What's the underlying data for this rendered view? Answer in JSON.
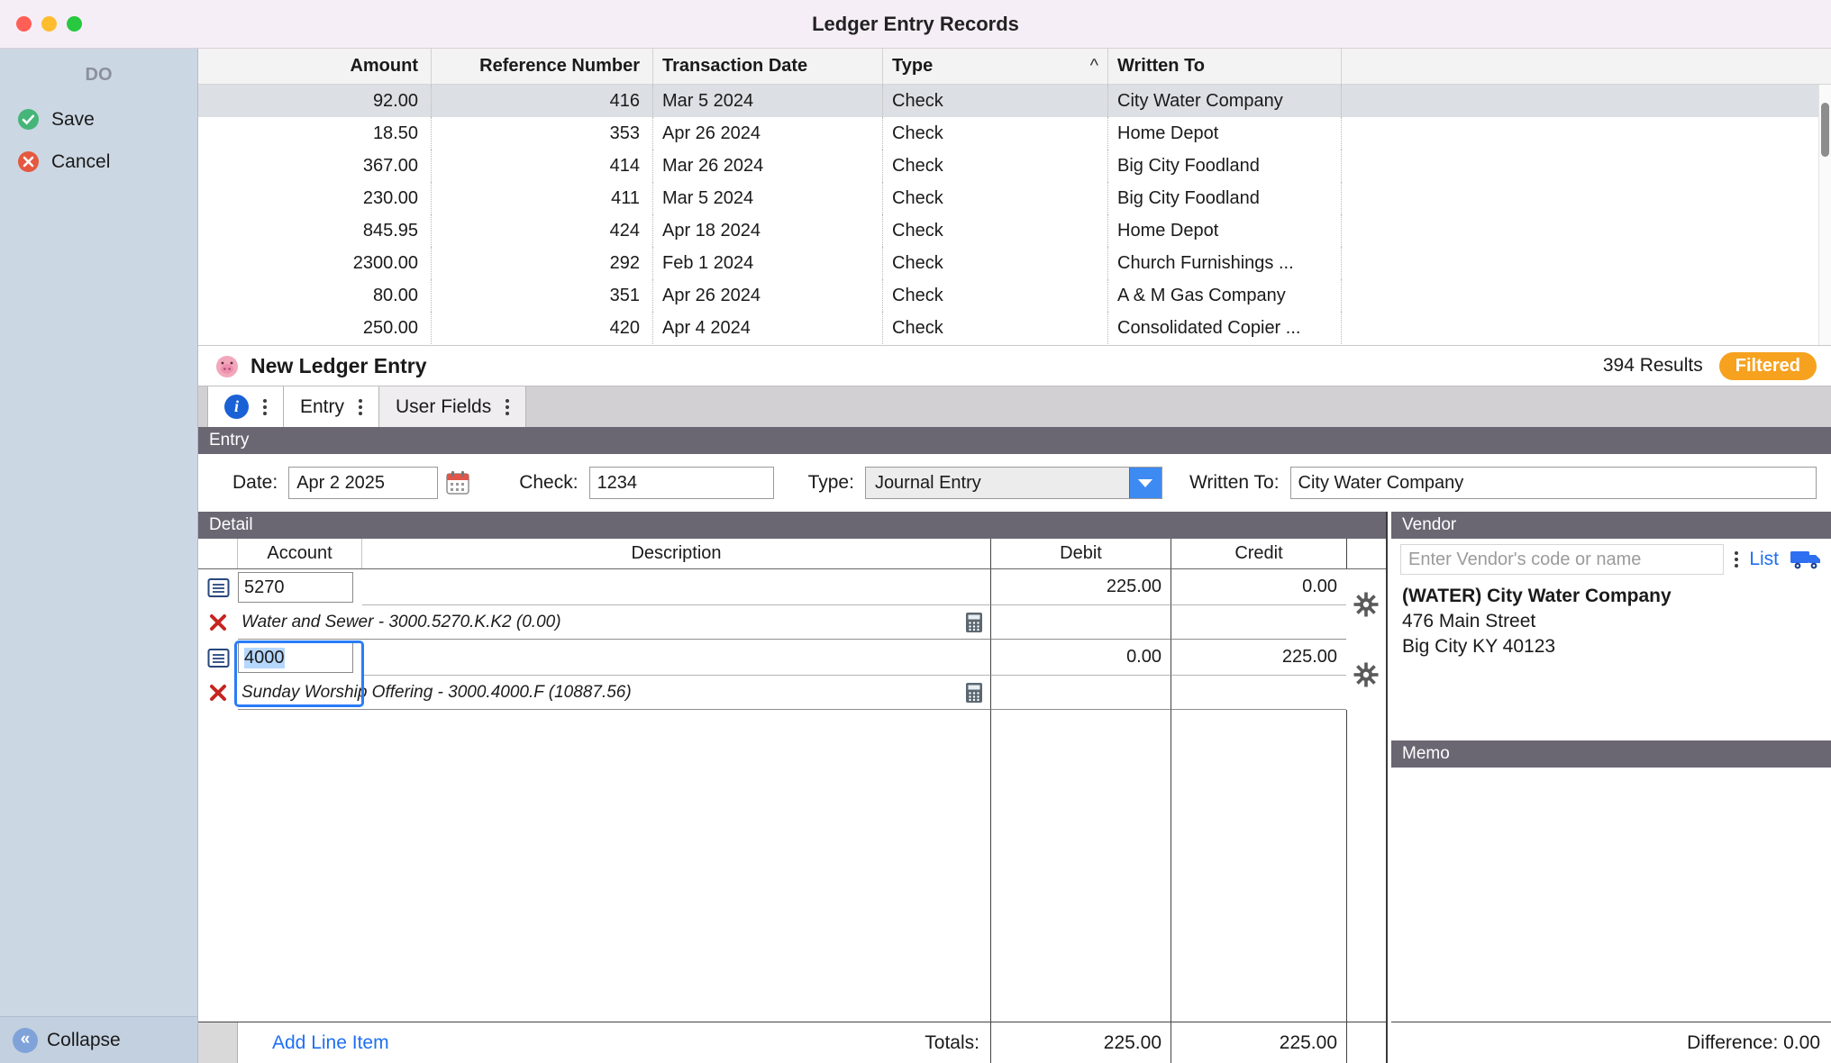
{
  "window": {
    "title": "Ledger Entry Records"
  },
  "sidebar": {
    "header": "DO",
    "save_label": "Save",
    "cancel_label": "Cancel",
    "collapse_label": "Collapse"
  },
  "records": {
    "columns": [
      "Amount",
      "Reference Number",
      "Transaction Date",
      "Type",
      "Written To"
    ],
    "sort_column": "Type",
    "rows": [
      {
        "amount": "92.00",
        "ref": "416",
        "date": "Mar 5 2024",
        "type": "Check",
        "written_to": "City Water Company"
      },
      {
        "amount": "18.50",
        "ref": "353",
        "date": "Apr 26 2024",
        "type": "Check",
        "written_to": "Home Depot"
      },
      {
        "amount": "367.00",
        "ref": "414",
        "date": "Mar 26 2024",
        "type": "Check",
        "written_to": "Big City Foodland"
      },
      {
        "amount": "230.00",
        "ref": "411",
        "date": "Mar 5 2024",
        "type": "Check",
        "written_to": "Big City Foodland"
      },
      {
        "amount": "845.95",
        "ref": "424",
        "date": "Apr 18 2024",
        "type": "Check",
        "written_to": "Home Depot"
      },
      {
        "amount": "2300.00",
        "ref": "292",
        "date": "Feb 1 2024",
        "type": "Check",
        "written_to": "Church Furnishings ..."
      },
      {
        "amount": "80.00",
        "ref": "351",
        "date": "Apr 26 2024",
        "type": "Check",
        "written_to": "A & M Gas Company"
      },
      {
        "amount": "250.00",
        "ref": "420",
        "date": "Apr 4 2024",
        "type": "Check",
        "written_to": "Consolidated Copier ..."
      }
    ]
  },
  "record_bar": {
    "title": "New Ledger Entry",
    "results": "394 Results",
    "filtered_badge": "Filtered"
  },
  "tabs": [
    {
      "label": "Entry"
    },
    {
      "label": "User Fields"
    }
  ],
  "entry": {
    "header": "Entry",
    "date_label": "Date:",
    "date_value": "Apr 2 2025",
    "check_label": "Check:",
    "check_value": "1234",
    "type_label": "Type:",
    "type_value": "Journal Entry",
    "written_to_label": "Written To:",
    "written_to_value": "City Water Company"
  },
  "detail": {
    "header": "Detail",
    "columns": [
      "Account",
      "Description",
      "Debit",
      "Credit"
    ],
    "items": [
      {
        "account": "5270",
        "description": "",
        "debit": "225.00",
        "credit": "0.00",
        "info": "Water and Sewer - 3000.5270.K.K2 (0.00)"
      },
      {
        "account": "4000",
        "description": "",
        "debit": "0.00",
        "credit": "225.00",
        "info": "Sunday Worship Offering - 3000.4000.F (10887.56)"
      }
    ],
    "add_line_item": "Add Line Item",
    "totals_label": "Totals:",
    "total_debit": "225.00",
    "total_credit": "225.00"
  },
  "vendor": {
    "header": "Vendor",
    "search_placeholder": "Enter Vendor's code or name",
    "list_label": "List",
    "name": "(WATER) City Water Company",
    "address1": "476 Main Street",
    "address2": "Big City KY 40123",
    "memo_header": "Memo",
    "difference_label": "Difference: 0.00"
  },
  "icons": {
    "sort_caret": "^",
    "collapse_chevrons": "«"
  },
  "colors": {
    "accent_blue": "#2b7cf7",
    "link_blue": "#1f6ff2",
    "filtered_orange": "#f6a21f",
    "section_header": "#6a6773",
    "selection_blue": "#b6d7fe",
    "selected_row": "#dcdfe3"
  }
}
